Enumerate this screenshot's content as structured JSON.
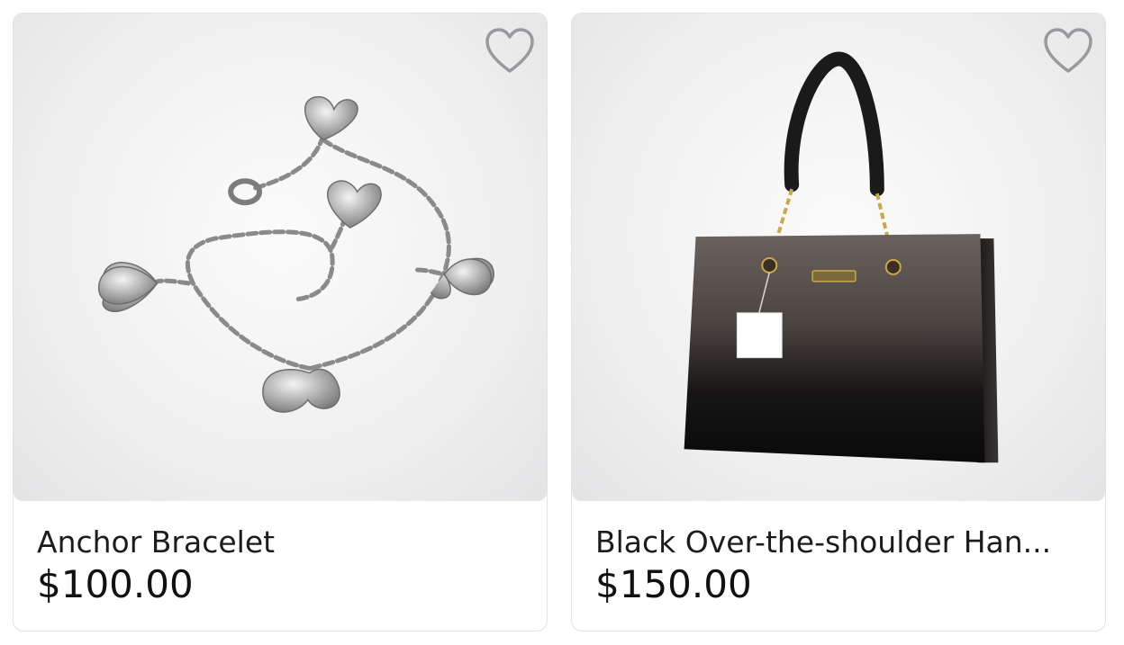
{
  "products": [
    {
      "name": "Anchor Bracelet",
      "price": "$100.00",
      "favorite_icon": "heart-outline-icon",
      "image": "silver heart charm bracelet"
    },
    {
      "name": "Black Over-the-shoulder Han...",
      "price": "$150.00",
      "favorite_icon": "heart-outline-icon",
      "image": "black patent leather handbag"
    }
  ],
  "colors": {
    "heart_outline": "#9a9a9e",
    "card_border": "#e2e2e4",
    "text": "#1c1c1e"
  }
}
